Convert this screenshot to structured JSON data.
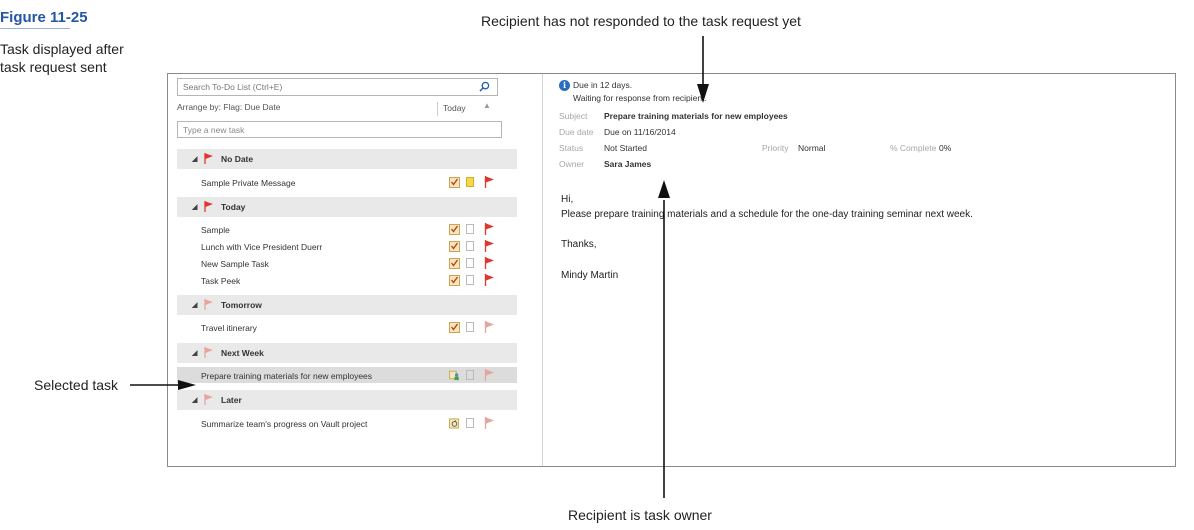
{
  "figure": {
    "title": "Figure 11-25",
    "caption_line1": "Task displayed after",
    "caption_line2": "task request sent"
  },
  "callouts": {
    "top": "Recipient has not responded to the task request yet",
    "left": "Selected task",
    "bottom": "Recipient is task owner"
  },
  "todo_list": {
    "search_placeholder": "Search To-Do List (Ctrl+E)",
    "arrange_by": "Arrange by: Flag: Due Date",
    "arrange_value": "Today",
    "new_task_placeholder": "Type a new task",
    "groups": [
      {
        "label": "No Date",
        "tasks": [
          "Sample Private Message"
        ]
      },
      {
        "label": "Today",
        "tasks": [
          "Sample",
          "Lunch with Vice President Duerr",
          "New Sample Task",
          "Task Peek"
        ]
      },
      {
        "label": "Tomorrow",
        "tasks": [
          "Travel itinerary"
        ]
      },
      {
        "label": "Next Week",
        "tasks": [
          "Prepare training materials for new employees"
        ]
      },
      {
        "label": "Later",
        "tasks": [
          "Summarize team's progress on Vault project"
        ]
      }
    ],
    "selected_task": "Prepare training materials for new employees"
  },
  "reading_pane": {
    "info_line1": "Due in 12 days.",
    "info_line2": "Waiting for response from recipient.",
    "subject_label": "Subject",
    "subject_value": "Prepare training materials for new employees",
    "due_label": "Due date",
    "due_value": "Due on 11/16/2014",
    "status_label": "Status",
    "status_value": "Not Started",
    "priority_label": "Priority",
    "priority_value": "Normal",
    "complete_label": "% Complete",
    "complete_value": "0%",
    "owner_label": "Owner",
    "owner_value": "Sara James",
    "body": {
      "greeting": "Hi,",
      "message": "Please prepare training materials and a schedule for the one-day training seminar next week.",
      "closing": "Thanks,",
      "signature": "Mindy Martin"
    }
  },
  "colors": {
    "accent": "#2456a4",
    "flag_red": "#e0362c",
    "flag_pale": "#e8a49f",
    "group_bg": "#e9e9e9",
    "info_blue": "#2a6fbf"
  },
  "icons": [
    "search-icon",
    "info-icon",
    "flag-icon",
    "task-icon",
    "category-box-icon",
    "assigned-task-icon",
    "recurring-task-icon",
    "collapse-triangle-icon"
  ]
}
